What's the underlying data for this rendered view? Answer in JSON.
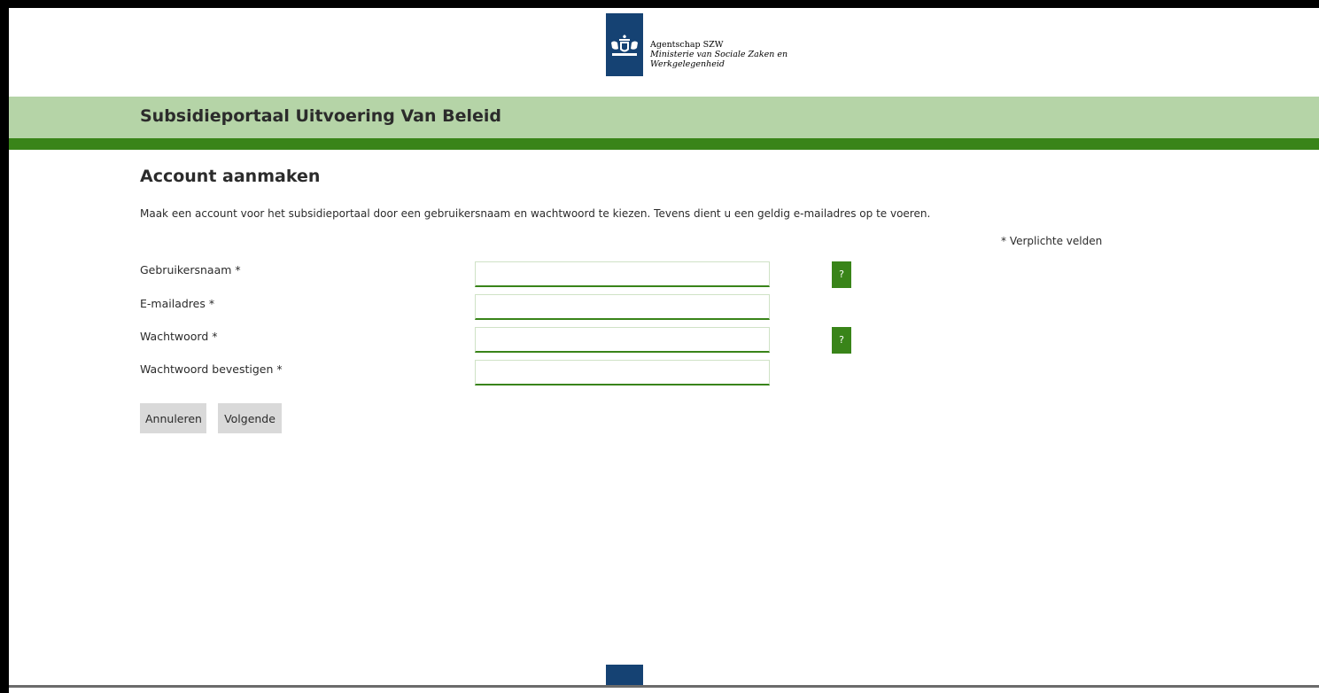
{
  "header": {
    "org_name": "Agentschap SZW",
    "ministry_line1": "Ministerie van Sociale Zaken en",
    "ministry_line2": "Werkgelegenheid",
    "logo_icon": "rijksoverheid-coat-of-arms-icon"
  },
  "banner": {
    "title": "Subsidieportaal Uitvoering Van Beleid"
  },
  "main": {
    "title": "Account aanmaken",
    "intro": "Maak een account voor het subsidieportaal door een gebruikersnaam en wachtwoord te kiezen. Tevens dient u een geldig e-mailadres op te voeren.",
    "required_note": "* Verplichte velden"
  },
  "form": {
    "fields": [
      {
        "label": "Gebruikersnaam *",
        "value": "",
        "help": "?"
      },
      {
        "label": "E-mailadres *",
        "value": ""
      },
      {
        "label": "Wachtwoord *",
        "value": "",
        "help": "?"
      },
      {
        "label": "Wachtwoord bevestigen *",
        "value": ""
      }
    ],
    "cancel_label": "Annuleren",
    "next_label": "Volgende"
  },
  "colors": {
    "banner_light_green": "#b5d4a7",
    "banner_dark_green": "#398419",
    "logo_blue": "#154273",
    "button_gray": "#d9d9d9"
  }
}
